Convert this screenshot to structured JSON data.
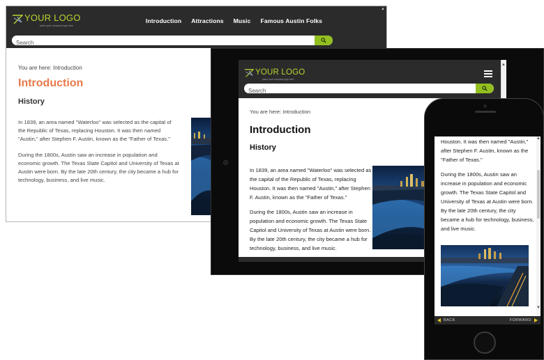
{
  "brand": {
    "logo_text": "YOUR LOGO",
    "logo_tagline": "place your company logo here",
    "accent_color": "#b9d531",
    "button_color": "#93c01f",
    "title_color_desktop": "#e8794a"
  },
  "nav": {
    "items": [
      "Introduction",
      "Attractions",
      "Music",
      "Famous Austin Folks"
    ]
  },
  "search": {
    "placeholder": "Search"
  },
  "page": {
    "breadcrumb": "You are here: Introduction",
    "title": "Introduction",
    "subtitle": "History",
    "paragraph1": "In 1839, an area named \"Waterloo\" was selected as the capital of the Republic of Texas, replacing Houston. It was then named \"Austin,\" after Stephen F. Austin, known as the \"Father of Texas.\"",
    "paragraph2": "During the 1800s, Austin saw an increase in population and economic growth. The Texas State Capitol and University of Texas at Austin were born. By the late 20th century, the city became a hub for technology, business, and live music.",
    "paragraph1_phone_fragment": "Houston. It was then named \"Austin,\" after Stephen F. Austin, known as the \"Father of Texas.\""
  },
  "phone_nav": {
    "back_label": "BACK",
    "forward_label": "FORWARD"
  },
  "icons": [
    "logo-mark-icon",
    "search-icon",
    "hamburger-menu-icon",
    "scroll-up-icon",
    "scroll-down-icon",
    "back-arrow-icon",
    "forward-arrow-icon"
  ]
}
